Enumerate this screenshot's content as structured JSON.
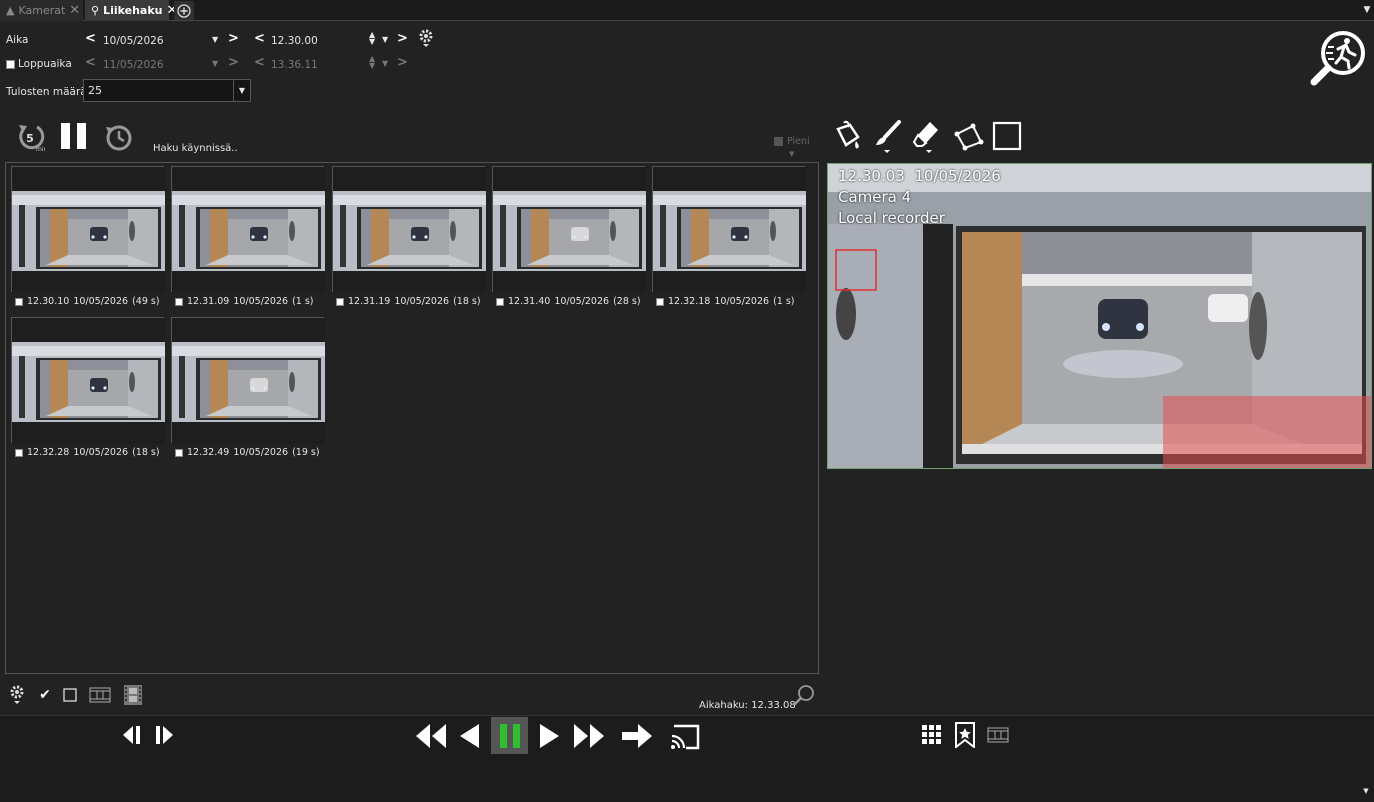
{
  "tabs": {
    "cameras_label": "Kamerat",
    "motion_search_label": "Liikehaku"
  },
  "time": {
    "start_label": "Aika",
    "start_date": "10/05/2026",
    "start_time": "12.30.00",
    "end_label": "Loppuaika",
    "end_date": "11/05/2026",
    "end_time": "13.36.11",
    "end_enabled": false
  },
  "results": {
    "count_label": "Tulosten määrä",
    "count_value": "25"
  },
  "status": {
    "text": "Haku käynnissä..",
    "rewind_minutes": "5",
    "rewind_unit": "min",
    "small_label": "Pieni"
  },
  "thumbnails": [
    {
      "time": "12.30.10",
      "date": "10/05/2026",
      "duration": "(49 s)"
    },
    {
      "time": "12.31.09",
      "date": "10/05/2026",
      "duration": "(1 s)"
    },
    {
      "time": "12.31.19",
      "date": "10/05/2026",
      "duration": "(18 s)"
    },
    {
      "time": "12.31.40",
      "date": "10/05/2026",
      "duration": "(28 s)"
    },
    {
      "time": "12.32.18",
      "date": "10/05/2026",
      "duration": "(1 s)"
    },
    {
      "time": "12.32.28",
      "date": "10/05/2026",
      "duration": "(18 s)"
    },
    {
      "time": "12.32.49",
      "date": "10/05/2026",
      "duration": "(19 s)"
    }
  ],
  "footer": {
    "time_search_label": "Aikahaku: 12.33.08"
  },
  "video": {
    "timestamp": "12.30.03  10/05/2026",
    "camera": "Camera 4",
    "recorder": "Local recorder"
  },
  "colors": {
    "play_active": "#2fbf2f",
    "region_mask": "#e05050",
    "video_border": "#6fa56f"
  },
  "icons": [
    "settings-icon",
    "motion-search-icon",
    "paint-bucket-icon",
    "brush-icon",
    "eraser-icon",
    "polygon-icon",
    "rectangle-icon",
    "rewind-5min-icon",
    "pause-icon",
    "history-icon",
    "check-icon",
    "grid-icon",
    "bookmark-icon",
    "film-icon",
    "search-icon"
  ]
}
